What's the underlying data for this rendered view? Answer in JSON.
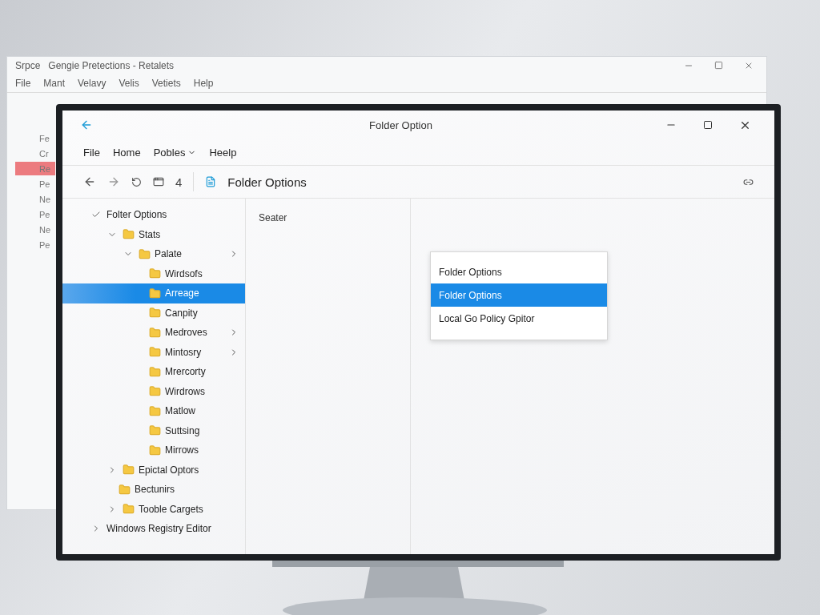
{
  "background_window": {
    "app_name": "Srpce",
    "title": "Gengie Pretections - Retalets",
    "menu": [
      "File",
      "Mant",
      "Velavy",
      "Velis",
      "Vetiets",
      "Help"
    ],
    "tree_fragments": [
      {
        "label": "Fe",
        "selected": false
      },
      {
        "label": "Cr",
        "selected": false
      },
      {
        "label": "Re",
        "selected": true
      },
      {
        "label": "Pe",
        "selected": false
      },
      {
        "label": "Ne",
        "selected": false
      },
      {
        "label": "Pe",
        "selected": false
      },
      {
        "label": "Ne",
        "selected": false
      },
      {
        "label": "Pe",
        "selected": false
      }
    ]
  },
  "window": {
    "title": "Folder Option"
  },
  "menu": [
    {
      "label": "File",
      "dropdown": false
    },
    {
      "label": "Home",
      "dropdown": false
    },
    {
      "label": "Pobles",
      "dropdown": true
    },
    {
      "label": "Heelp",
      "dropdown": false
    }
  ],
  "toolbar": {
    "count": "4",
    "location": "Folder Options"
  },
  "tree": [
    {
      "label": "Folter Options",
      "selected": false,
      "expanded": true,
      "chevron": false,
      "children": [
        {
          "label": "Stats",
          "selected": false,
          "expanded": true,
          "chevron": false,
          "children": [
            {
              "label": "Palate",
              "selected": false,
              "expanded": true,
              "chevron": true,
              "children": [
                {
                  "label": "Wirdsofs",
                  "selected": false,
                  "chevron": false
                },
                {
                  "label": "Arreage",
                  "selected": true,
                  "chevron": false
                },
                {
                  "label": "Canpity",
                  "selected": false,
                  "chevron": false
                },
                {
                  "label": "Medroves",
                  "selected": false,
                  "chevron": true
                },
                {
                  "label": "Mintosry",
                  "selected": false,
                  "chevron": true
                },
                {
                  "label": "Mrercorty",
                  "selected": false,
                  "chevron": false
                },
                {
                  "label": "Wirdrows",
                  "selected": false,
                  "chevron": false
                },
                {
                  "label": "Matlow",
                  "selected": false,
                  "chevron": false
                },
                {
                  "label": "Suttsing",
                  "selected": false,
                  "chevron": false
                },
                {
                  "label": "Mirrows",
                  "selected": false,
                  "chevron": false
                }
              ]
            }
          ]
        },
        {
          "label": "Epictal Optors",
          "selected": false,
          "expanded": false,
          "chevron": false
        },
        {
          "label": "Bectunirs",
          "selected": false,
          "chevron": false
        },
        {
          "label": "Tooble Cargets",
          "selected": false,
          "expanded": false,
          "chevron": false
        }
      ]
    },
    {
      "label": "Windows Registry Editor",
      "selected": false,
      "expanded": false,
      "chevron": false
    }
  ],
  "middle_pane": {
    "heading": "Seater"
  },
  "popup_menu": [
    {
      "label": "Folder Options",
      "selected": false
    },
    {
      "label": "Folder Options",
      "selected": true
    },
    {
      "label": "Local Go Policy Gpitor",
      "selected": false
    }
  ]
}
